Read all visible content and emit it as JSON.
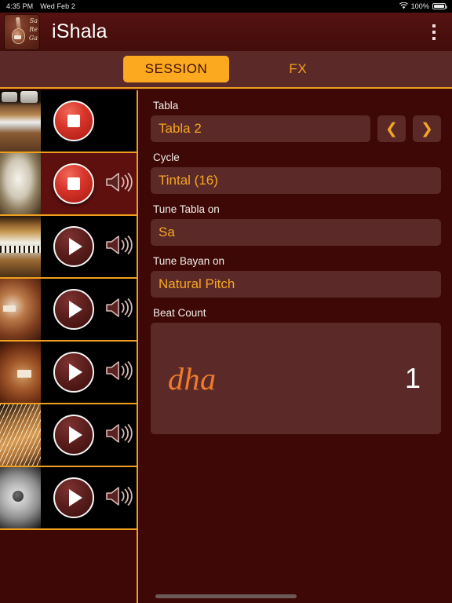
{
  "status_bar": {
    "time": "4:35 PM",
    "date": "Wed Feb 2",
    "wifi_icon": "wifi-icon",
    "battery_percent": "100%",
    "battery_icon": "battery-icon"
  },
  "header": {
    "logo_icon": "app-logo-icon",
    "logo_sargam": "Sa Re Ga",
    "title": "iShala",
    "overflow_icon": "overflow-menu-icon"
  },
  "tabs": [
    {
      "label": "SESSION",
      "active": true
    },
    {
      "label": "FX",
      "active": false
    }
  ],
  "tracks": [
    {
      "instrument": "shruti-box",
      "state": "stop",
      "button_icon": "stop-icon",
      "has_speaker": false,
      "speaker_icon": "speaker-icon",
      "selected": false
    },
    {
      "instrument": "tabla",
      "state": "stop",
      "button_icon": "stop-icon",
      "has_speaker": true,
      "speaker_icon": "speaker-icon",
      "selected": true
    },
    {
      "instrument": "harmonium",
      "state": "play",
      "button_icon": "play-icon",
      "has_speaker": true,
      "speaker_icon": "speaker-icon",
      "selected": false
    },
    {
      "instrument": "tanpura-male",
      "state": "play",
      "button_icon": "play-icon",
      "has_speaker": true,
      "speaker_icon": "speaker-icon",
      "selected": false
    },
    {
      "instrument": "tanpura-female",
      "state": "play",
      "button_icon": "play-icon",
      "has_speaker": true,
      "speaker_icon": "speaker-icon",
      "selected": false
    },
    {
      "instrument": "santoor",
      "state": "play",
      "button_icon": "play-icon",
      "has_speaker": true,
      "speaker_icon": "speaker-icon",
      "selected": false
    },
    {
      "instrument": "cymbal",
      "state": "play",
      "button_icon": "play-icon",
      "has_speaker": true,
      "speaker_icon": "speaker-icon",
      "selected": false
    }
  ],
  "session": {
    "tabla": {
      "label": "Tabla",
      "value": "Tabla 2",
      "prev_icon": "chevron-left-icon",
      "next_icon": "chevron-right-icon"
    },
    "cycle": {
      "label": "Cycle",
      "value": "Tintal (16)"
    },
    "tune_tabla": {
      "label": "Tune Tabla on",
      "value": "Sa"
    },
    "tune_bayan": {
      "label": "Tune Bayan on",
      "value": "Natural Pitch"
    },
    "beat_count": {
      "label": "Beat Count",
      "bol": "dha",
      "count": "1"
    }
  },
  "colors": {
    "background": "#3d0806",
    "panel_field": "#5b2a28",
    "accent_orange": "#f0a01e",
    "value_orange": "#f5a623",
    "bol_orange": "#f07b2a",
    "header": "#4a0f0d",
    "stop_red": "#d8352a"
  },
  "home_indicator": "home-indicator"
}
